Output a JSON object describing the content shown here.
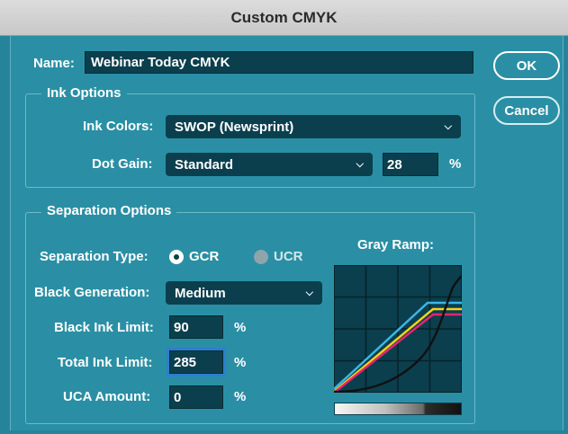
{
  "window": {
    "title": "Custom CMYK"
  },
  "name": {
    "label": "Name:",
    "value": "Webinar Today CMYK"
  },
  "ink_options": {
    "legend": "Ink Options",
    "ink_colors_label": "Ink Colors:",
    "ink_colors_value": "SWOP (Newsprint)",
    "dot_gain_label": "Dot Gain:",
    "dot_gain_value": "Standard",
    "dot_gain_amount": "28",
    "dot_gain_unit": "%"
  },
  "separation_options": {
    "legend": "Separation Options",
    "separation_type_label": "Separation Type:",
    "gcr_label": "GCR",
    "ucr_label": "UCR",
    "selected": "GCR",
    "black_generation_label": "Black Generation:",
    "black_generation_value": "Medium",
    "black_ink_limit_label": "Black Ink Limit:",
    "black_ink_limit_value": "90",
    "total_ink_limit_label": "Total Ink Limit:",
    "total_ink_limit_value": "285",
    "uca_amount_label": "UCA Amount:",
    "uca_amount_value": "0",
    "percent": "%",
    "gray_ramp_label": "Gray Ramp:"
  },
  "buttons": {
    "ok": "OK",
    "cancel": "Cancel"
  },
  "colors": {
    "background": "#2a8fa4",
    "field": "#0b3f4e",
    "cyan_curve": "#3ab6e6",
    "yellow_curve": "#f2d21a",
    "magenta_curve": "#e3266f",
    "black_curve": "#111111"
  }
}
